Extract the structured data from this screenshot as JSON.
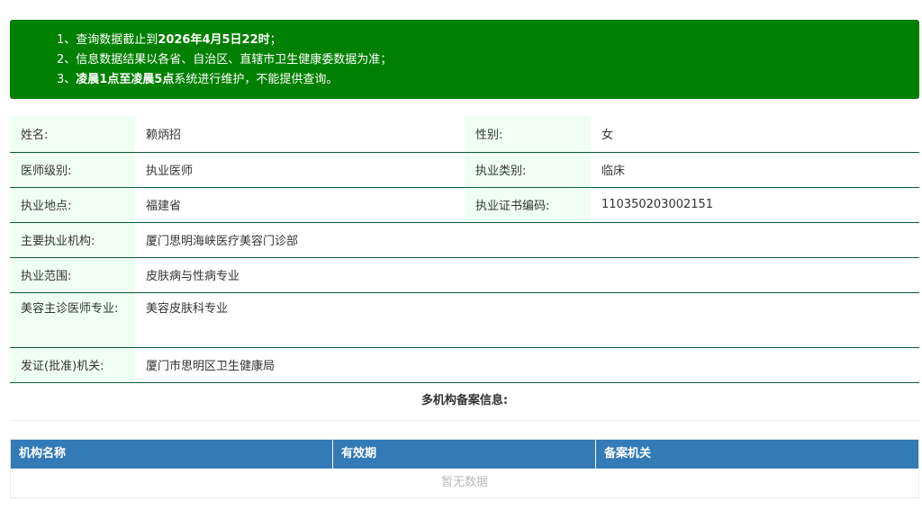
{
  "notice": {
    "lines": [
      "1、查询数据截止到2026年4月5日22时；",
      "2、信息数据结果以各省、自治区、直辖市卫生健康委数据为准；",
      "3、凌晨1点至凌晨5点系统进行维护，不能提供查询。"
    ]
  },
  "doctor": {
    "name_label": "姓名:",
    "name": "赖炳招",
    "gender_label": "性别:",
    "gender": "女",
    "level_label": "医师级别:",
    "level": "执业医师",
    "category_label": "执业类别:",
    "category": "临床",
    "location_label": "执业地点:",
    "location": "福建省",
    "cert_label": "执业证书编码:",
    "cert": "110350203002151",
    "institution_label": "主要执业机构:",
    "institution": "厦门思明海峡医疗美容门诊部",
    "scope_label": "执业范围:",
    "scope": "皮肤病与性病专业",
    "beauty_label": "美容主诊医师专业:",
    "beauty": "美容皮肤科专业",
    "authority_label": "发证(批准)机关:",
    "authority": "厦门市思明区卫生健康局"
  },
  "multi": {
    "title": "多机构备案信息:",
    "columns": [
      "机构名称",
      "有效期",
      "备案机关"
    ],
    "empty_text": "暂无数据"
  },
  "colors": {
    "notice_bg": "#008000",
    "label_bg": "#f0fff4",
    "row_border": "#0b5a3a",
    "table_header_bg": "#337ab7"
  }
}
